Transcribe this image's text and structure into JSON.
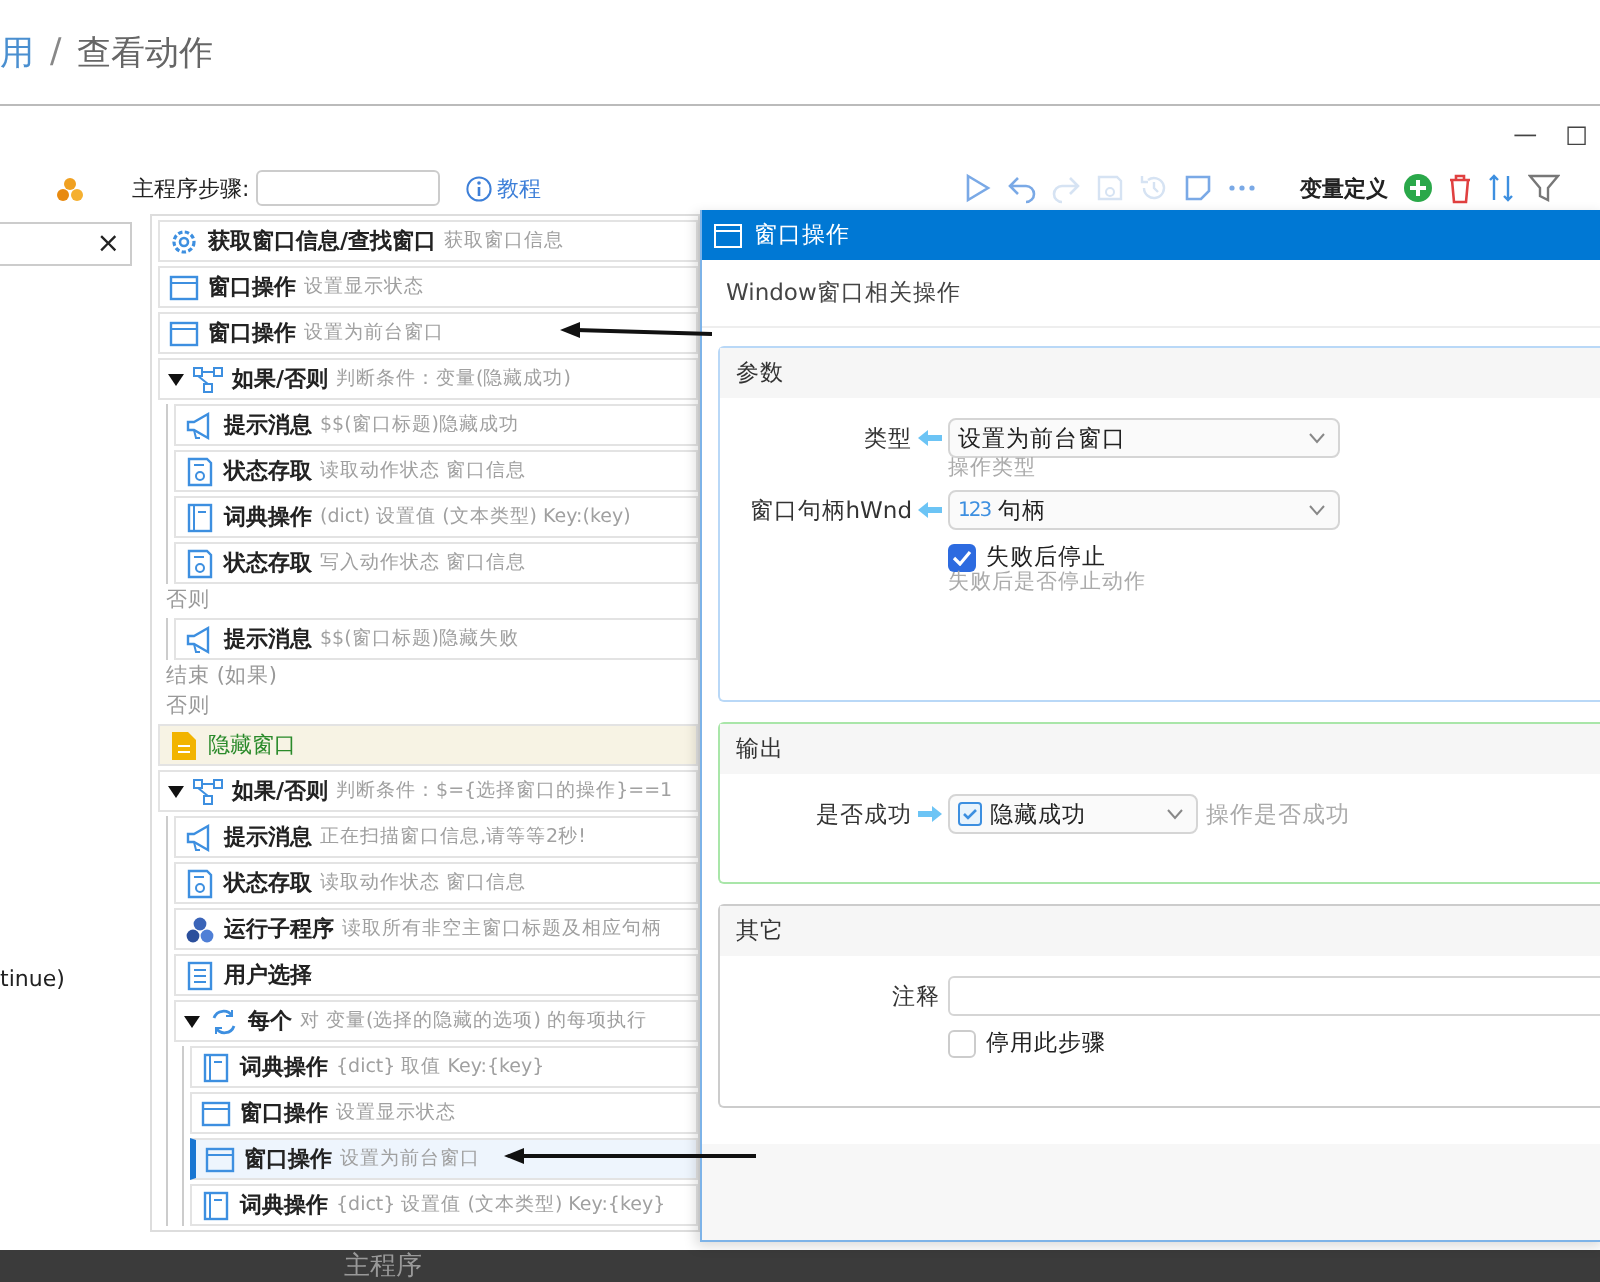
{
  "breadcrumb": {
    "items": [
      {
        "label": "用",
        "link": true
      },
      {
        "label": "查看动作",
        "link": false
      }
    ],
    "separator": "/"
  },
  "window_controls": [
    "—",
    "□"
  ],
  "left_panel": {
    "search_clear": "×",
    "fragment": "tinue)"
  },
  "toolbar": {
    "label": "主程序步骤:",
    "help_link": "教程",
    "actions": [
      {
        "kind": "run",
        "disabled": false
      },
      {
        "kind": "undo",
        "disabled": false
      },
      {
        "kind": "redo",
        "disabled": true
      },
      {
        "kind": "save",
        "disabled": true
      },
      {
        "kind": "history",
        "disabled": true
      },
      {
        "kind": "note",
        "disabled": false
      },
      {
        "kind": "more",
        "disabled": false
      }
    ]
  },
  "variables": {
    "label": "变量定义",
    "actions": [
      {
        "kind": "add"
      },
      {
        "kind": "delete"
      },
      {
        "kind": "sort"
      },
      {
        "kind": "filter"
      }
    ]
  },
  "steps": {
    "items": [
      {
        "kind": "gear",
        "title": "获取窗口信息/查找窗口",
        "desc": "获取窗口信息",
        "selected": false
      },
      {
        "kind": "window",
        "title": "窗口操作",
        "desc": "设置显示状态",
        "selected": false
      },
      {
        "kind": "window",
        "title": "窗口操作",
        "desc": "设置为前台窗口",
        "selected": false
      },
      {
        "kind": "if",
        "expanded": true,
        "title": "如果/否则",
        "desc": "判断条件：变量(隐藏成功)",
        "selected": false,
        "children": [
          {
            "kind": "message",
            "title": "提示消息",
            "desc": "$$(窗口标题)隐藏成功",
            "selected": false
          },
          {
            "kind": "disk",
            "title": "状态存取",
            "desc": "读取动作状态  窗口信息",
            "selected": false
          },
          {
            "kind": "dict",
            "title": "词典操作",
            "desc": "(dict) 设置值 (文本类型) Key:(key)",
            "selected": false
          },
          {
            "kind": "disk",
            "title": "状态存取",
            "desc": "写入动作状态  窗口信息",
            "selected": false
          }
        ],
        "else_label": "否则",
        "else_children": [
          {
            "kind": "message",
            "title": "提示消息",
            "desc": "$$(窗口标题)隐藏失败",
            "selected": false
          }
        ],
        "end_label": "结束 (如果)"
      }
    ],
    "else_label": "否则",
    "else_items": [
      {
        "kind": "label",
        "title": "隐藏窗口"
      },
      {
        "kind": "if",
        "expanded": true,
        "title": "如果/否则",
        "desc": "判断条件：$={选择窗口的操作}==1",
        "selected": false,
        "children": [
          {
            "kind": "message",
            "title": "提示消息",
            "desc": "正在扫描窗口信息,请等等2秒!",
            "selected": false
          },
          {
            "kind": "disk",
            "title": "状态存取",
            "desc": "读取动作状态  窗口信息",
            "selected": false
          },
          {
            "kind": "subprogram",
            "title": "运行子程序",
            "desc": "读取所有非空主窗口标题及相应句柄",
            "selected": false
          },
          {
            "kind": "list",
            "title": "用户选择",
            "selected": false
          },
          {
            "kind": "loop",
            "expanded": true,
            "title": "每个",
            "desc": "对 变量(选择的隐藏的选项) 的每项执行",
            "selected": false,
            "children": [
              {
                "kind": "dict",
                "title": "词典操作",
                "desc": "{dict} 取值 Key:{key}",
                "selected": false
              },
              {
                "kind": "window",
                "title": "窗口操作",
                "desc": "设置显示状态",
                "selected": false
              },
              {
                "kind": "window",
                "title": "窗口操作",
                "desc": "设置为前台窗口",
                "selected": true
              },
              {
                "kind": "dict",
                "title": "词典操作",
                "desc": "{dict} 设置值 (文本类型) Key:{key}",
                "selected": false
              }
            ]
          }
        ]
      }
    ]
  },
  "dialog": {
    "title": "窗口操作",
    "subtitle": "Window窗口相关操作",
    "sections": [
      {
        "kind": "params",
        "title": "参数",
        "fields": [
          {
            "kind": "select",
            "label": "类型",
            "value": "设置为前台窗口",
            "hint": "操作类型"
          },
          {
            "kind": "select",
            "label": "窗口句柄hWnd",
            "type_badge": "123",
            "value": "句柄"
          },
          {
            "kind": "checkbox",
            "label": "失败后停止",
            "checked": true,
            "hint": "失败后是否停止动作"
          }
        ]
      },
      {
        "kind": "output",
        "title": "输出",
        "fields": [
          {
            "kind": "output_select",
            "label": "是否成功",
            "value": "隐藏成功",
            "side_hint": "操作是否成功"
          }
        ]
      },
      {
        "kind": "other",
        "title": "其它",
        "fields": [
          {
            "kind": "text",
            "label": "注释"
          },
          {
            "kind": "checkbox",
            "label": "停用此步骤",
            "checked": false
          }
        ]
      }
    ]
  },
  "bottom_bar": {
    "tab": "主程序"
  }
}
